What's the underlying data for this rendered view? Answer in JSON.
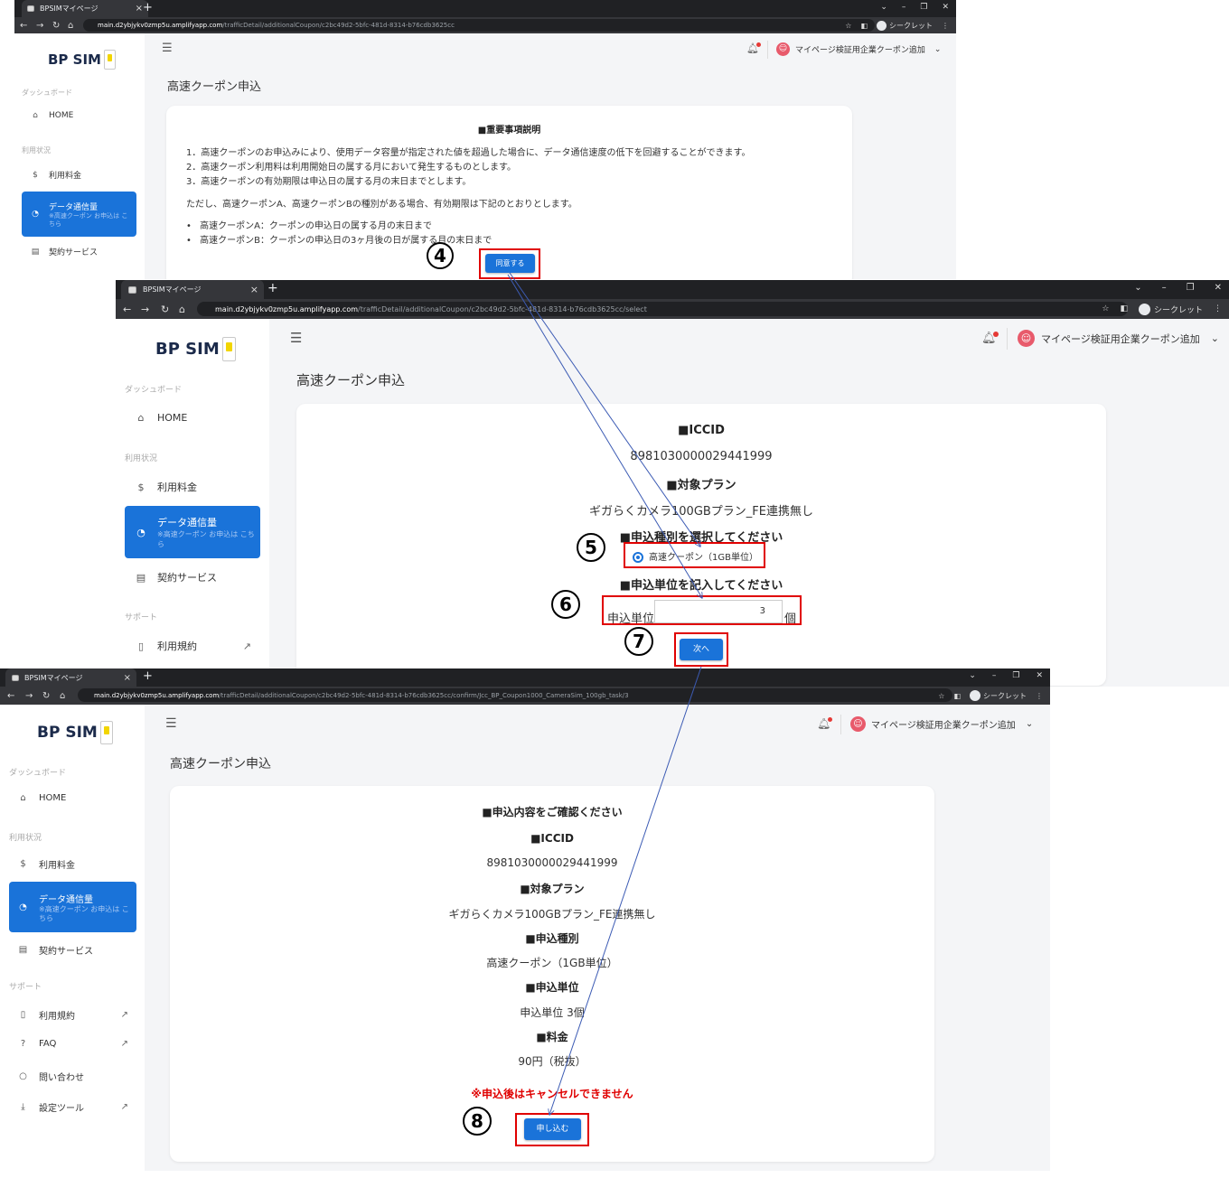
{
  "browser": {
    "tab_title": "BPSIMマイページ",
    "new_tab": "+",
    "close": "×",
    "incognito": "シークレット",
    "url_host": "main.d2ybjykv0zmp5u.amplifyapp.com",
    "url_path_1": "/trafficDetail/additionalCoupon/c2bc49d2-5bfc-481d-8314-b76cdb3625cc",
    "url_path_2": "/trafficDetail/additionalCoupon/c2bc49d2-5bfc-481d-8314-b76cdb3625cc/select",
    "url_path_3": "/trafficDetail/additionalCoupon/c2bc49d2-5bfc-481d-8314-b76cdb3625cc/confirm/Jcc_BP_Coupon1000_CameraSim_100gb_task/3"
  },
  "sidebar": {
    "logo": "BP SIM",
    "dashboard": "ダッシュボード",
    "home": "HOME",
    "usage": "利用状況",
    "fee": "利用料金",
    "data": "データ通信量",
    "data_note": "※高速クーポン お申込は こちら",
    "contract": "契約サービス",
    "support": "サポート",
    "terms": "利用規約",
    "faq": "FAQ",
    "contact": "問い合わせ",
    "tools": "設定ツール"
  },
  "header": {
    "user": "マイページ検証用企業クーポン追加"
  },
  "page_title": "高速クーポン申込",
  "step1": {
    "heading": "■重要事項説明",
    "item1": "1．高速クーポンのお申込みにより、使用データ容量が指定された値を超過した場合に、データ通信速度の低下を回避することができます。",
    "item2": "2．高速クーポン利用料は利用開始日の属する月において発生するものとします。",
    "item3": "3．高速クーポンの有効期限は申込日の属する月の末日までとします。",
    "note": "ただし、高速クーポンA、高速クーポンBの種別がある場合、有効期限は下記のとおりとします。",
    "bullet1": "高速クーポンA：クーポンの申込日の属する月の末日まで",
    "bullet2": "高速クーポンB：クーポンの申込日の3ヶ月後の日が属する月の末日まで",
    "agree_button": "同意する"
  },
  "step2": {
    "iccid_heading": "■ICCID",
    "iccid": "8981030000029441999",
    "plan_heading": "■対象プラン",
    "plan": "ギガらくカメラ100GBプラン_FE連携無し",
    "type_heading": "■申込種別を選択してください",
    "type_option": "高速クーポン（1GB単位）",
    "unit_heading": "■申込単位を記入してください",
    "unit_label": "申込単位",
    "unit_value": "3",
    "unit_suffix": "個",
    "next_button": "次へ"
  },
  "step3": {
    "confirm_heading": "■申込内容をご確認ください",
    "iccid_heading": "■ICCID",
    "iccid": "8981030000029441999",
    "plan_heading": "■対象プラン",
    "plan": "ギガらくカメラ100GBプラン_FE連携無し",
    "type_heading": "■申込種別",
    "type": "高速クーポン（1GB単位）",
    "unit_heading": "■申込単位",
    "unit": "申込単位 3個",
    "fee_heading": "■料金",
    "fee": "90円（税抜）",
    "warning": "※申込後はキャンセルできません",
    "apply_button": "申し込む"
  },
  "steps": {
    "s4": "4",
    "s5": "5",
    "s6": "6",
    "s7": "7",
    "s8": "8"
  },
  "colors": {
    "accent": "#1a73d9",
    "annotation": "#e00000",
    "arrow": "#3c5bb4"
  }
}
